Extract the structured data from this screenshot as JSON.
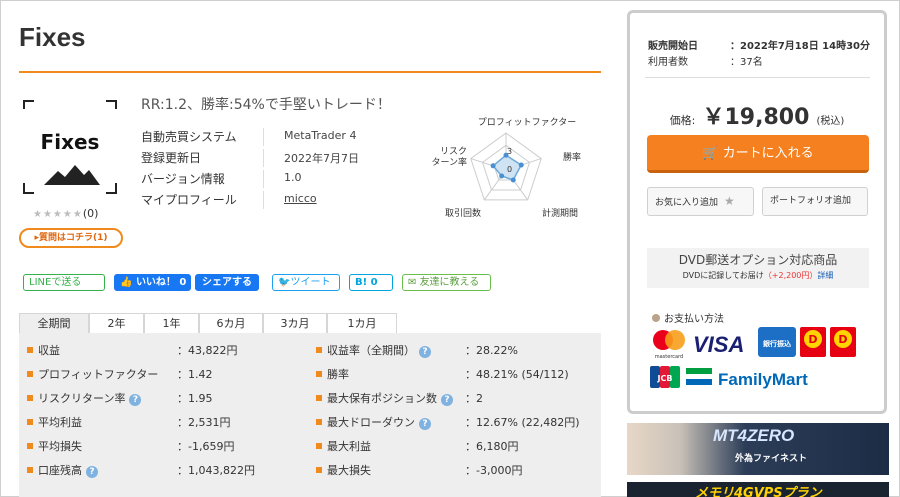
{
  "product": {
    "title": "Fixes",
    "logo_text": "Fixes",
    "rating_count": "(0)",
    "review_link": "▸質問はコチラ(1)",
    "catch": "RR:1.2、勝率:54%で手堅いトレード！",
    "info": [
      {
        "key": "自動売買システム",
        "value": "MetaTrader 4"
      },
      {
        "key": "登録更新日",
        "value": "2022年7月7日"
      },
      {
        "key": "バージョン情報",
        "value": "1.0"
      },
      {
        "key": "マイプロフィール",
        "value": "micco"
      }
    ]
  },
  "radar": {
    "labels": {
      "top": "プロフィットファクター",
      "right": "勝率",
      "bottom_right": "計測期間",
      "bottom_left": "取引回数",
      "left1": "リスク",
      "left2": "ターン率"
    },
    "tick_3": "3",
    "tick_0": "0",
    "values": [
      1.2,
      1.3,
      1.0,
      0.6,
      1.1
    ]
  },
  "share": {
    "line": "LINEで送る",
    "like": "いいね！ 0",
    "fb_share": "シェアする",
    "tweet": "ツイート",
    "hatena": "B! 0",
    "friend": "友達に教える"
  },
  "tabs": [
    "全期間",
    "2年",
    "1年",
    "6カ月",
    "3カ月",
    "1カ月"
  ],
  "stats": {
    "left": [
      {
        "key": "収益",
        "value": "：43,822円",
        "help": false
      },
      {
        "key": "プロフィットファクター",
        "value": "：1.42",
        "help": false
      },
      {
        "key": "リスクリターン率",
        "value": "：1.95",
        "help": true
      },
      {
        "key": "平均利益",
        "value": "：2,531円",
        "help": false
      },
      {
        "key": "平均損失",
        "value": "：-1,659円",
        "help": false
      },
      {
        "key": "口座残高",
        "value": "：1,043,822円",
        "help": true
      }
    ],
    "right": [
      {
        "key": "収益率（全期間）",
        "value": "：28.22%",
        "help": true
      },
      {
        "key": "勝率",
        "value": "：48.21% (54/112)",
        "help": false
      },
      {
        "key": "最大保有ポジション数",
        "value": "：2",
        "help": true
      },
      {
        "key": "最大ドローダウン",
        "value": "：12.67% (22,482円)",
        "help": true
      },
      {
        "key": "最大利益",
        "value": "：6,180円",
        "help": false
      },
      {
        "key": "最大損失",
        "value": "：-3,000円",
        "help": false
      }
    ]
  },
  "sidebar": {
    "sale_start_label": "販売開始日",
    "sale_start_value": "：2022年7月18日 14時30分",
    "users_label": "利用者数",
    "users_value": "：37名",
    "price_label": "価格:",
    "price": "￥19,800",
    "tax": "(税込)",
    "cart": "カートに入れる",
    "favorite": "お気に入り追加",
    "portfolio": "ポートフォリオ追加",
    "dvd_title": "DVD郵送オプション対応商品",
    "dvd_sub": "DVDに記録してお届け",
    "dvd_price": "（+2,200円）",
    "dvd_detail": "詳細",
    "payment_title": "お支払い方法",
    "payments": {
      "mastercard": "mastercard",
      "visa": "VISA",
      "bank": "銀行振込",
      "jcb": "JCB",
      "familymart": "FamilyMart"
    }
  },
  "banners": {
    "mt4zero": "MT4ZERO",
    "mt4zero_sub": "外為ファイネスト",
    "vps": "メモリ4GVPSプラン"
  },
  "colors": {
    "accent": "#f08a1c",
    "cart": "#f5801f",
    "facebook": "#1877f2",
    "line": "#35b34a"
  }
}
